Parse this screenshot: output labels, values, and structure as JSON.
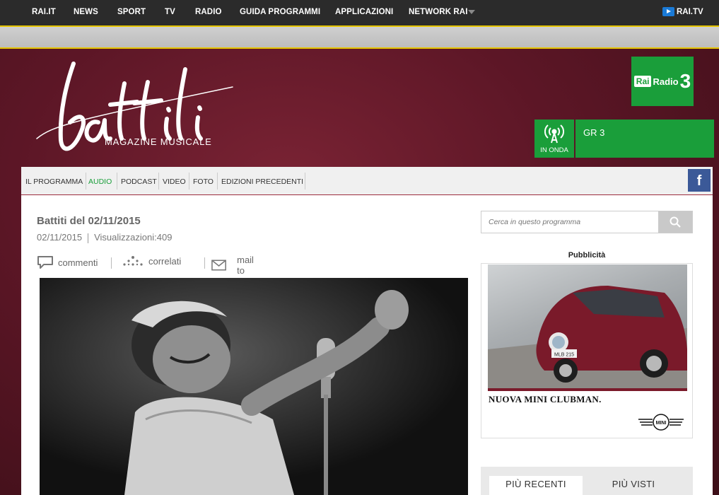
{
  "topnav": {
    "items": [
      "RAI.IT",
      "NEWS",
      "SPORT",
      "TV",
      "RADIO",
      "GUIDA PROGRAMMI",
      "APPLICAZIONI",
      "NETWORK RAI"
    ],
    "raitv_label": "RAI.TV"
  },
  "header": {
    "logo_text": "MAGAZINE MUSICALE",
    "channel_logo": {
      "rai": "Rai",
      "radio": "Radio",
      "number": "3"
    },
    "on_air_label": "IN ONDA",
    "on_air_program": "GR 3",
    "accent_color": "#1a9e3a"
  },
  "subnav": {
    "items": [
      "IL PROGRAMMA",
      "AUDIO",
      "PODCAST",
      "VIDEO",
      "FOTO",
      "EDIZIONI PRECEDENTI"
    ],
    "active_index": 1,
    "facebook_label": "f"
  },
  "article": {
    "title": "Battiti del 02/11/2015",
    "date": "02/11/2015",
    "views": "Visualizzazioni:409",
    "actions": [
      "commenti",
      "correlati",
      "mail to"
    ]
  },
  "sidebar": {
    "search_placeholder": "Cerca in questo programma",
    "ad_label": "Pubblicità",
    "ad_caption": "NUOVA MINI CLUBMAN.",
    "ad_brand": "MINI",
    "ad_plate": "MLB 215",
    "tabs": [
      "PIÙ RECENTI",
      "PIÙ VISTI"
    ],
    "active_tab": 0
  }
}
